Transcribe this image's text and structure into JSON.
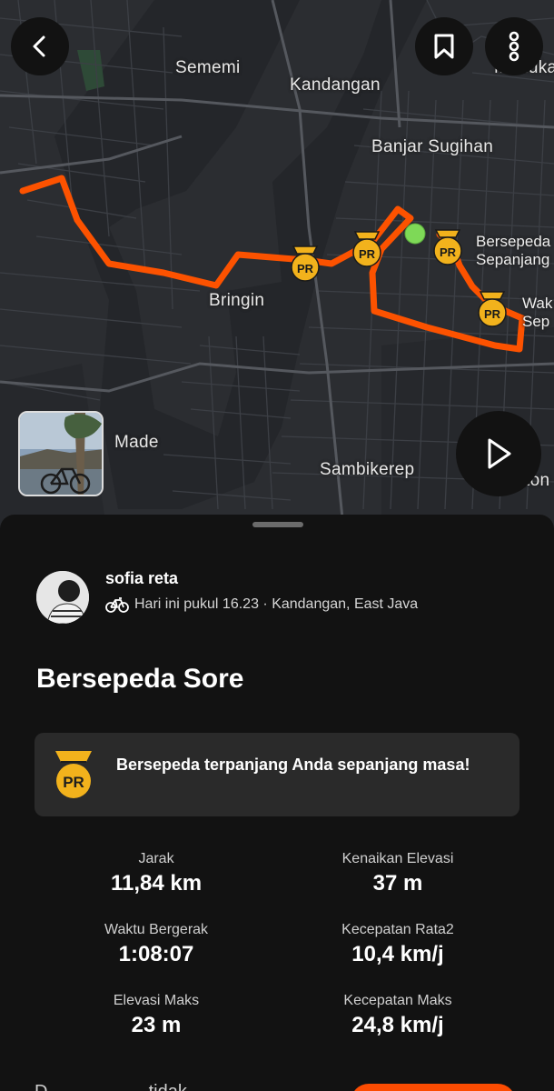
{
  "map": {
    "places": {
      "sememi": "Sememi",
      "kandangan": "Kandangan",
      "banjar_sugihan": "Banjar Sugihan",
      "bringin": "Bringin",
      "made": "Made",
      "sambikerep": "Sambikerep",
      "edge_top_right": "Manuka",
      "edge_right": "ton"
    },
    "segment_labels": {
      "seg1_line1": "Bersepeda",
      "seg1_line2": "Sepanjang",
      "seg2_line1": "Wak",
      "seg2_line2": "Sep"
    },
    "pr_badge_text": "PR",
    "colors": {
      "route": "#fc5200",
      "start_marker": "#7ed957",
      "pr_gold": "#f2b21c",
      "map_bg": "#2b2d31"
    },
    "buttons": {
      "back_icon": "chevron-left-icon",
      "save_icon": "bookmark-icon",
      "more_icon": "more-vertical-icon",
      "play_icon": "play-icon"
    }
  },
  "activity": {
    "athlete_name": "sofia reta",
    "meta": "Hari ini pukul 16.23 · Kandangan, East Java",
    "sport_icon": "bike-icon",
    "title": "Bersepeda Sore",
    "achievement": "Bersepeda terpanjang Anda sepanjang masa!",
    "stats": [
      {
        "label": "Jarak",
        "value": "11,84 km"
      },
      {
        "label": "Kenaikan Elevasi",
        "value": "37 m"
      },
      {
        "label": "Waktu Bergerak",
        "value": "1:08:07"
      },
      {
        "label": "Kecepatan Rata2",
        "value": "10,4 km/j"
      },
      {
        "label": "Elevasi Maks",
        "value": "23 m"
      },
      {
        "label": "Kecepatan Maks",
        "value": "24,8 km/j"
      }
    ],
    "cutoff_text": "D ... ... ... ... ...tidak"
  }
}
